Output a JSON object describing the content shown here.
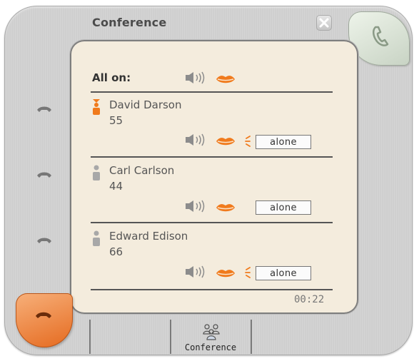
{
  "window": {
    "title": "Conference"
  },
  "panel": {
    "all_on_label": "All on:",
    "timer": "00:22"
  },
  "participants": [
    {
      "name": "David Darson",
      "number": "55",
      "alone_label": "alone",
      "status": "active",
      "talking": true
    },
    {
      "name": "Carl Carlson",
      "number": "44",
      "alone_label": "alone",
      "status": "idle",
      "talking": false
    },
    {
      "name": "Edward Edison",
      "number": "66",
      "alone_label": "alone",
      "status": "idle",
      "talking": true
    }
  ],
  "tabs": [
    {
      "label": "Conference",
      "icon": "conference-icon"
    }
  ],
  "colors": {
    "accent_orange": "#e56a1f",
    "panel_bg": "#f4ecdd",
    "shell_gray": "#d0d0d0",
    "call_green": "#dfe9da"
  }
}
